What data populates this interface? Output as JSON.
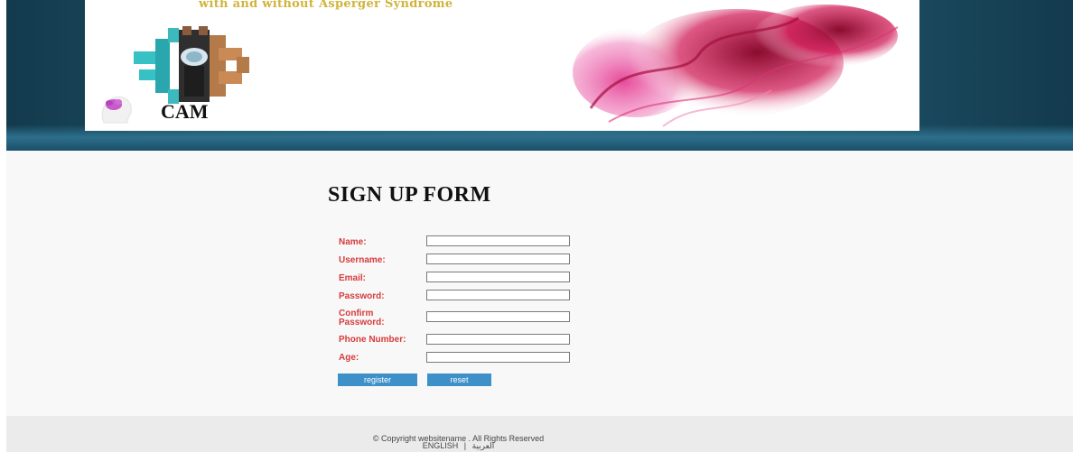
{
  "header": {
    "tagline": "with and without Asperger Syndrome",
    "logo_text": "CAM"
  },
  "form": {
    "title": "SIGN UP FORM",
    "fields": [
      {
        "label": "Name:",
        "value": ""
      },
      {
        "label": "Username:",
        "value": ""
      },
      {
        "label": "Email:",
        "value": ""
      },
      {
        "label": "Password:",
        "value": ""
      },
      {
        "label": "Confirm Password:",
        "value": ""
      },
      {
        "label": "Phone Number:",
        "value": ""
      },
      {
        "label": "Age:",
        "value": ""
      }
    ],
    "register_label": "register",
    "reset_label": "reset"
  },
  "footer": {
    "copyright": "© Copyright websitename . All Rights Reserved",
    "lang_english": "ENGLISH",
    "lang_separator": "|",
    "lang_arabic": "العربية"
  },
  "colors": {
    "label_red": "#d63b3b",
    "button_blue": "#3d90c8",
    "header_dark": "#133a4d"
  }
}
